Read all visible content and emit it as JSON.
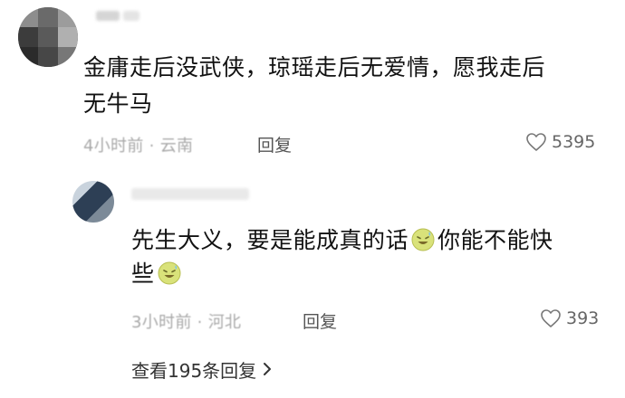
{
  "comments": [
    {
      "text_line1": "金庸走后没武侠，琼瑶走后无爱情，愿我走后",
      "text_line2": "无牛马",
      "time": "4小时前",
      "location": "云南",
      "reply_label": "回复",
      "likes": "5395",
      "username_visible": false,
      "avatar_icon": "pixelated-avatar"
    },
    {
      "text_line1_a": "先生大义，要是能成真的话",
      "text_line1_b": "你能不能快",
      "text_line2": "些",
      "time": "3小时前",
      "location": "河北",
      "reply_label": "回复",
      "likes": "393",
      "username_visible": false,
      "avatar_icon": "pixelated-avatar",
      "emoji_icon": "sweat-smile-emoji"
    }
  ],
  "view_replies": {
    "label": "查看195条回复",
    "icon": "chevron-right-icon"
  },
  "colors": {
    "text": "#121212",
    "meta": "#a9a9a9",
    "reply": "#555555",
    "emoji": "#d9e27a"
  }
}
